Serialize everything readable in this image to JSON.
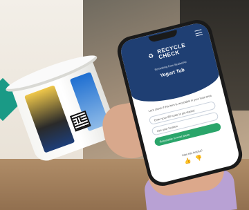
{
  "app": {
    "logo_line1": "RECYCLE",
    "logo_line2": "CHECK",
    "logo_sub": "Something from Sealed Air",
    "product_name": "Yogurt Tub"
  },
  "screen": {
    "prompt": "Let's check if this item is recyclable in your local area",
    "option_1": "Enter your ZIP code to get started",
    "option_2": "Use your location",
    "option_3": "Recyclable in most areas",
    "feedback_label": "Was this helpful?",
    "feedback_icons": "👍 👎"
  },
  "colors": {
    "brand_navy": "#1f3f73",
    "accent_green": "#2aa56a",
    "accent_teal": "#1a9a86"
  }
}
